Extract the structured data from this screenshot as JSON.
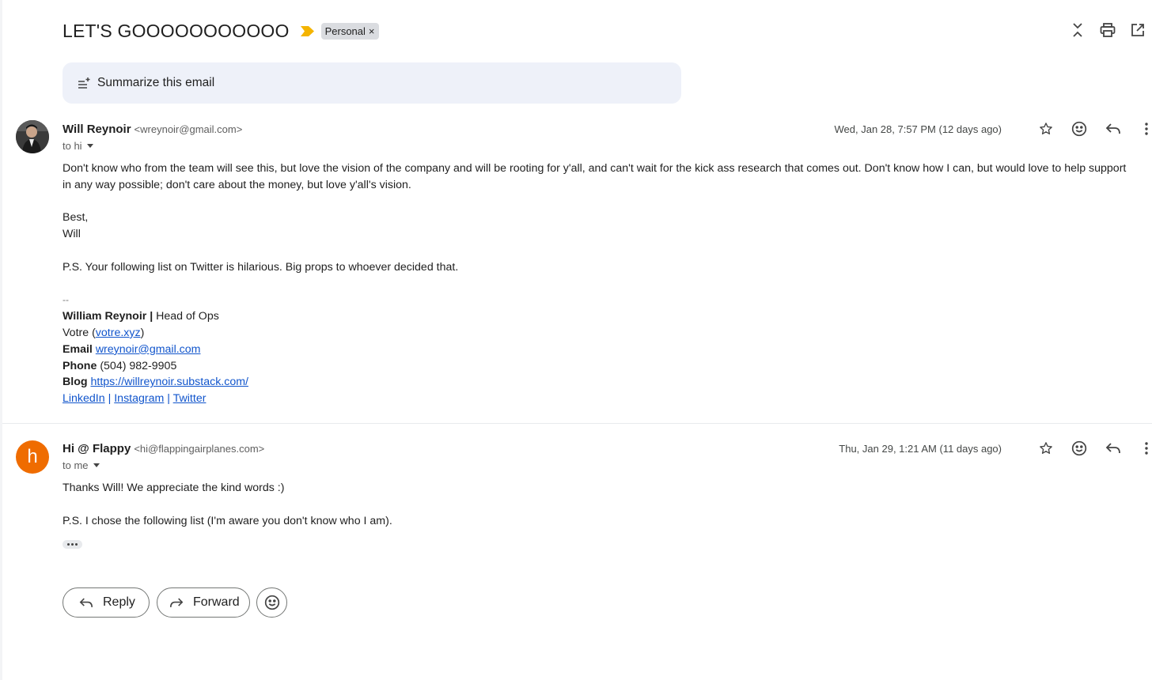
{
  "thread": {
    "subject": "LET'S GOOOOOOOOOOO",
    "label": "Personal",
    "label_remove": "×",
    "summarize_label": "Summarize this email"
  },
  "messages": [
    {
      "sender_name": "Will Reynoir",
      "sender_email": "<wreynoir@gmail.com>",
      "to": "to hi",
      "date": "Wed, Jan 28, 7:57 PM (12 days ago)",
      "paragraphs": [
        "Don't know who from the team will see this, but love the vision of the company and will be rooting for y'all, and can't wait for the kick ass research that comes out. Don't know how I can, but would love to help support in any way possible; don't care about the money, but love y'all's vision.",
        "Best,",
        "Will",
        "P.S. Your following list on Twitter is hilarious. Big props to whoever decided that."
      ],
      "signature": {
        "dash": "--",
        "name": "William Reynoir |",
        "title": " Head of Ops",
        "company": "Votre (",
        "company_link": "votre.xyz",
        "company_close": ")",
        "email_label": "Email",
        "email": "wreynoir@gmail.com",
        "phone_label": "Phone",
        "phone": "(504) 982-9905",
        "blog_label": "Blog",
        "blog": "https://willreynoir.substack.com/",
        "socials": [
          "LinkedIn",
          "Instagram",
          "Twitter"
        ],
        "social_sep": "|"
      }
    },
    {
      "sender_name": "Hi @ Flappy",
      "sender_email": "<hi@flappingairplanes.com>",
      "avatar_letter": "h",
      "to": "to me",
      "date": "Thu, Jan 29, 1:21 AM (11 days ago)",
      "paragraphs": [
        "Thanks Will! We appreciate the kind words :)",
        "P.S. I chose the following list (I'm aware you don't know who I am)."
      ]
    }
  ],
  "actions": {
    "reply_label": "Reply",
    "forward_label": "Forward"
  },
  "icons": {
    "importance": "importance-marker-icon",
    "collapse": "collapse-all-icon",
    "print": "print-icon",
    "open_new": "open-in-new-window-icon",
    "star": "star-icon",
    "emoji": "emoji-icon",
    "reply": "reply-icon",
    "more": "more-vert-icon",
    "forward": "forward-icon",
    "summarize": "summarize-icon"
  },
  "colors": {
    "importance": "#f4b400",
    "link": "#1155cc",
    "avatar_orange": "#ef6c00",
    "summarize_bg": "#eef1f9",
    "label_bg": "#dadce0"
  }
}
